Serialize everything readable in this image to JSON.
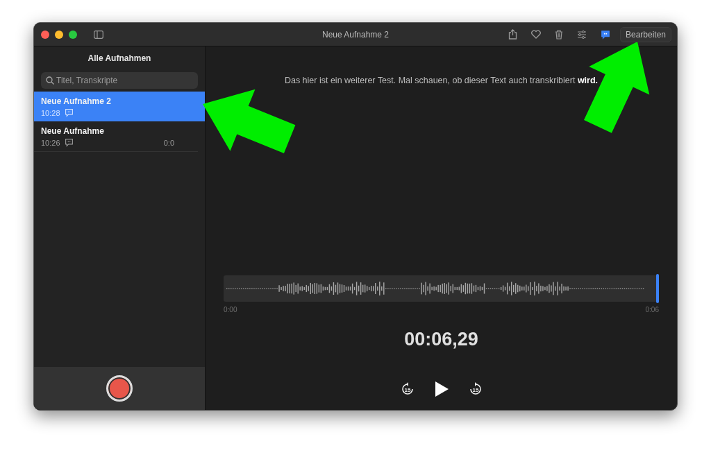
{
  "window": {
    "title": "Neue Aufnahme 2"
  },
  "toolbar": {
    "transcript_selected": true,
    "edit_button": "Bearbeiten"
  },
  "sidebar": {
    "title": "Alle Aufnahmen",
    "search": {
      "placeholder": "Titel, Transkripte"
    },
    "recordings": [
      {
        "name": "Neue Aufnahme 2",
        "time": "10:28",
        "selected": true
      },
      {
        "name": "Neue Aufnahme",
        "time": "10:26",
        "duration": "0:0",
        "selected": false
      }
    ]
  },
  "transcript": "Das hier ist ein weiterer Test. Mal schauen, ob dieser Text auch transkribiert **wird.**",
  "player": {
    "start": "0:00",
    "end": "0:06",
    "level": 1,
    "elapsed": "00:06,29",
    "skip_back": "15",
    "skip_forward": "15"
  }
}
